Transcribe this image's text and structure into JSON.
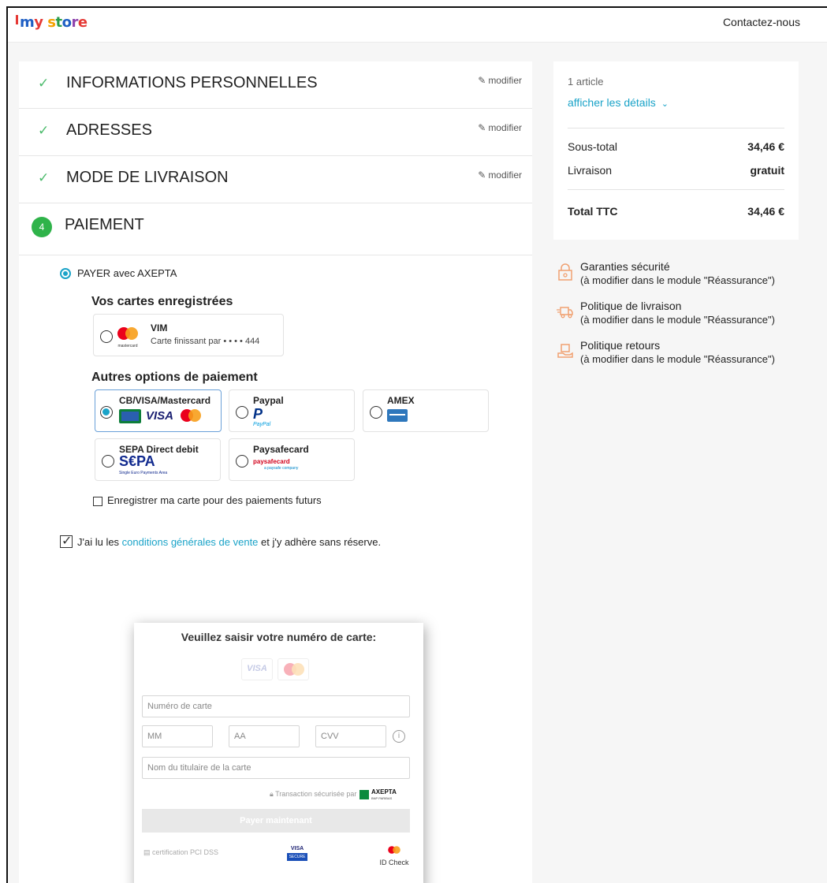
{
  "header": {
    "logo_text": "my store",
    "contact_label": "Contactez-nous"
  },
  "steps": [
    {
      "title": "INFORMATIONS PERSONNELLES",
      "edit_label": "modifier",
      "done": true
    },
    {
      "title": "ADRESSES",
      "edit_label": "modifier",
      "done": true
    },
    {
      "title": "MODE DE LIVRAISON",
      "edit_label": "modifier",
      "done": true
    },
    {
      "title": "PAIEMENT",
      "number": "4",
      "done": false
    }
  ],
  "payment": {
    "method_label": "PAYER avec AXEPTA",
    "saved_cards_heading": "Vos cartes enregistrées",
    "saved_card": {
      "name": "VIM",
      "ending_text": "Carte finissant par • • • • 444",
      "brand_text": "mastercard"
    },
    "other_options_heading": "Autres options de paiement",
    "options": [
      {
        "label": "CB/VISA/Mastercard",
        "selected": true
      },
      {
        "label": "Paypal",
        "selected": false,
        "sub": "PayPal"
      },
      {
        "label": "AMEX",
        "selected": false
      },
      {
        "label": "SEPA Direct debit",
        "selected": false,
        "sub": "S€PA",
        "sub2": "Single Euro Payments Area"
      },
      {
        "label": "Paysafecard",
        "selected": false,
        "sub": "paysafecard",
        "sub2": "a paysafe company"
      }
    ],
    "save_card_label": "Enregistrer ma carte pour des paiements futurs",
    "terms_prefix": "J'ai lu les ",
    "terms_link": "conditions générales de vente",
    "terms_suffix": " et j'y adhère sans réserve."
  },
  "card_form": {
    "title": "Veuillez saisir votre numéro de carte:",
    "visa_label": "VISA",
    "card_number_placeholder": "Numéro de carte",
    "mm_placeholder": "MM",
    "aa_placeholder": "AA",
    "cvv_placeholder": "CVV",
    "holder_placeholder": "Nom du titulaire de la carte",
    "secure_text": "Transaction sécurisée par",
    "axepta_label": "AXEPTA",
    "axepta_sub": "BNP PARIBAS",
    "pay_button": "Payer maintenant",
    "pci_text": "certification PCI DSS",
    "visa_secure_top": "VISA",
    "visa_secure_bottom": "SECURE",
    "id_check": "ID Check"
  },
  "summary": {
    "articles": "1 article",
    "details_link": "afficher les détails",
    "subtotal_label": "Sous-total",
    "subtotal_value": "34,46 €",
    "shipping_label": "Livraison",
    "shipping_value": "gratuit",
    "total_label": "Total TTC",
    "total_value": "34,46 €"
  },
  "reassurance": [
    {
      "title": "Garanties sécurité",
      "text": "(à modifier dans le module \"Réassurance\")",
      "icon": "lock-icon"
    },
    {
      "title": "Politique de livraison",
      "text": "(à modifier dans le module \"Réassurance\")",
      "icon": "delivery-truck-icon"
    },
    {
      "title": "Politique retours",
      "text": "(à modifier dans le module \"Réassurance\")",
      "icon": "return-box-icon"
    }
  ],
  "colors": {
    "accent": "#1aa3c8",
    "success": "#2fb34a",
    "reassurance_icon": "#f0a070"
  }
}
